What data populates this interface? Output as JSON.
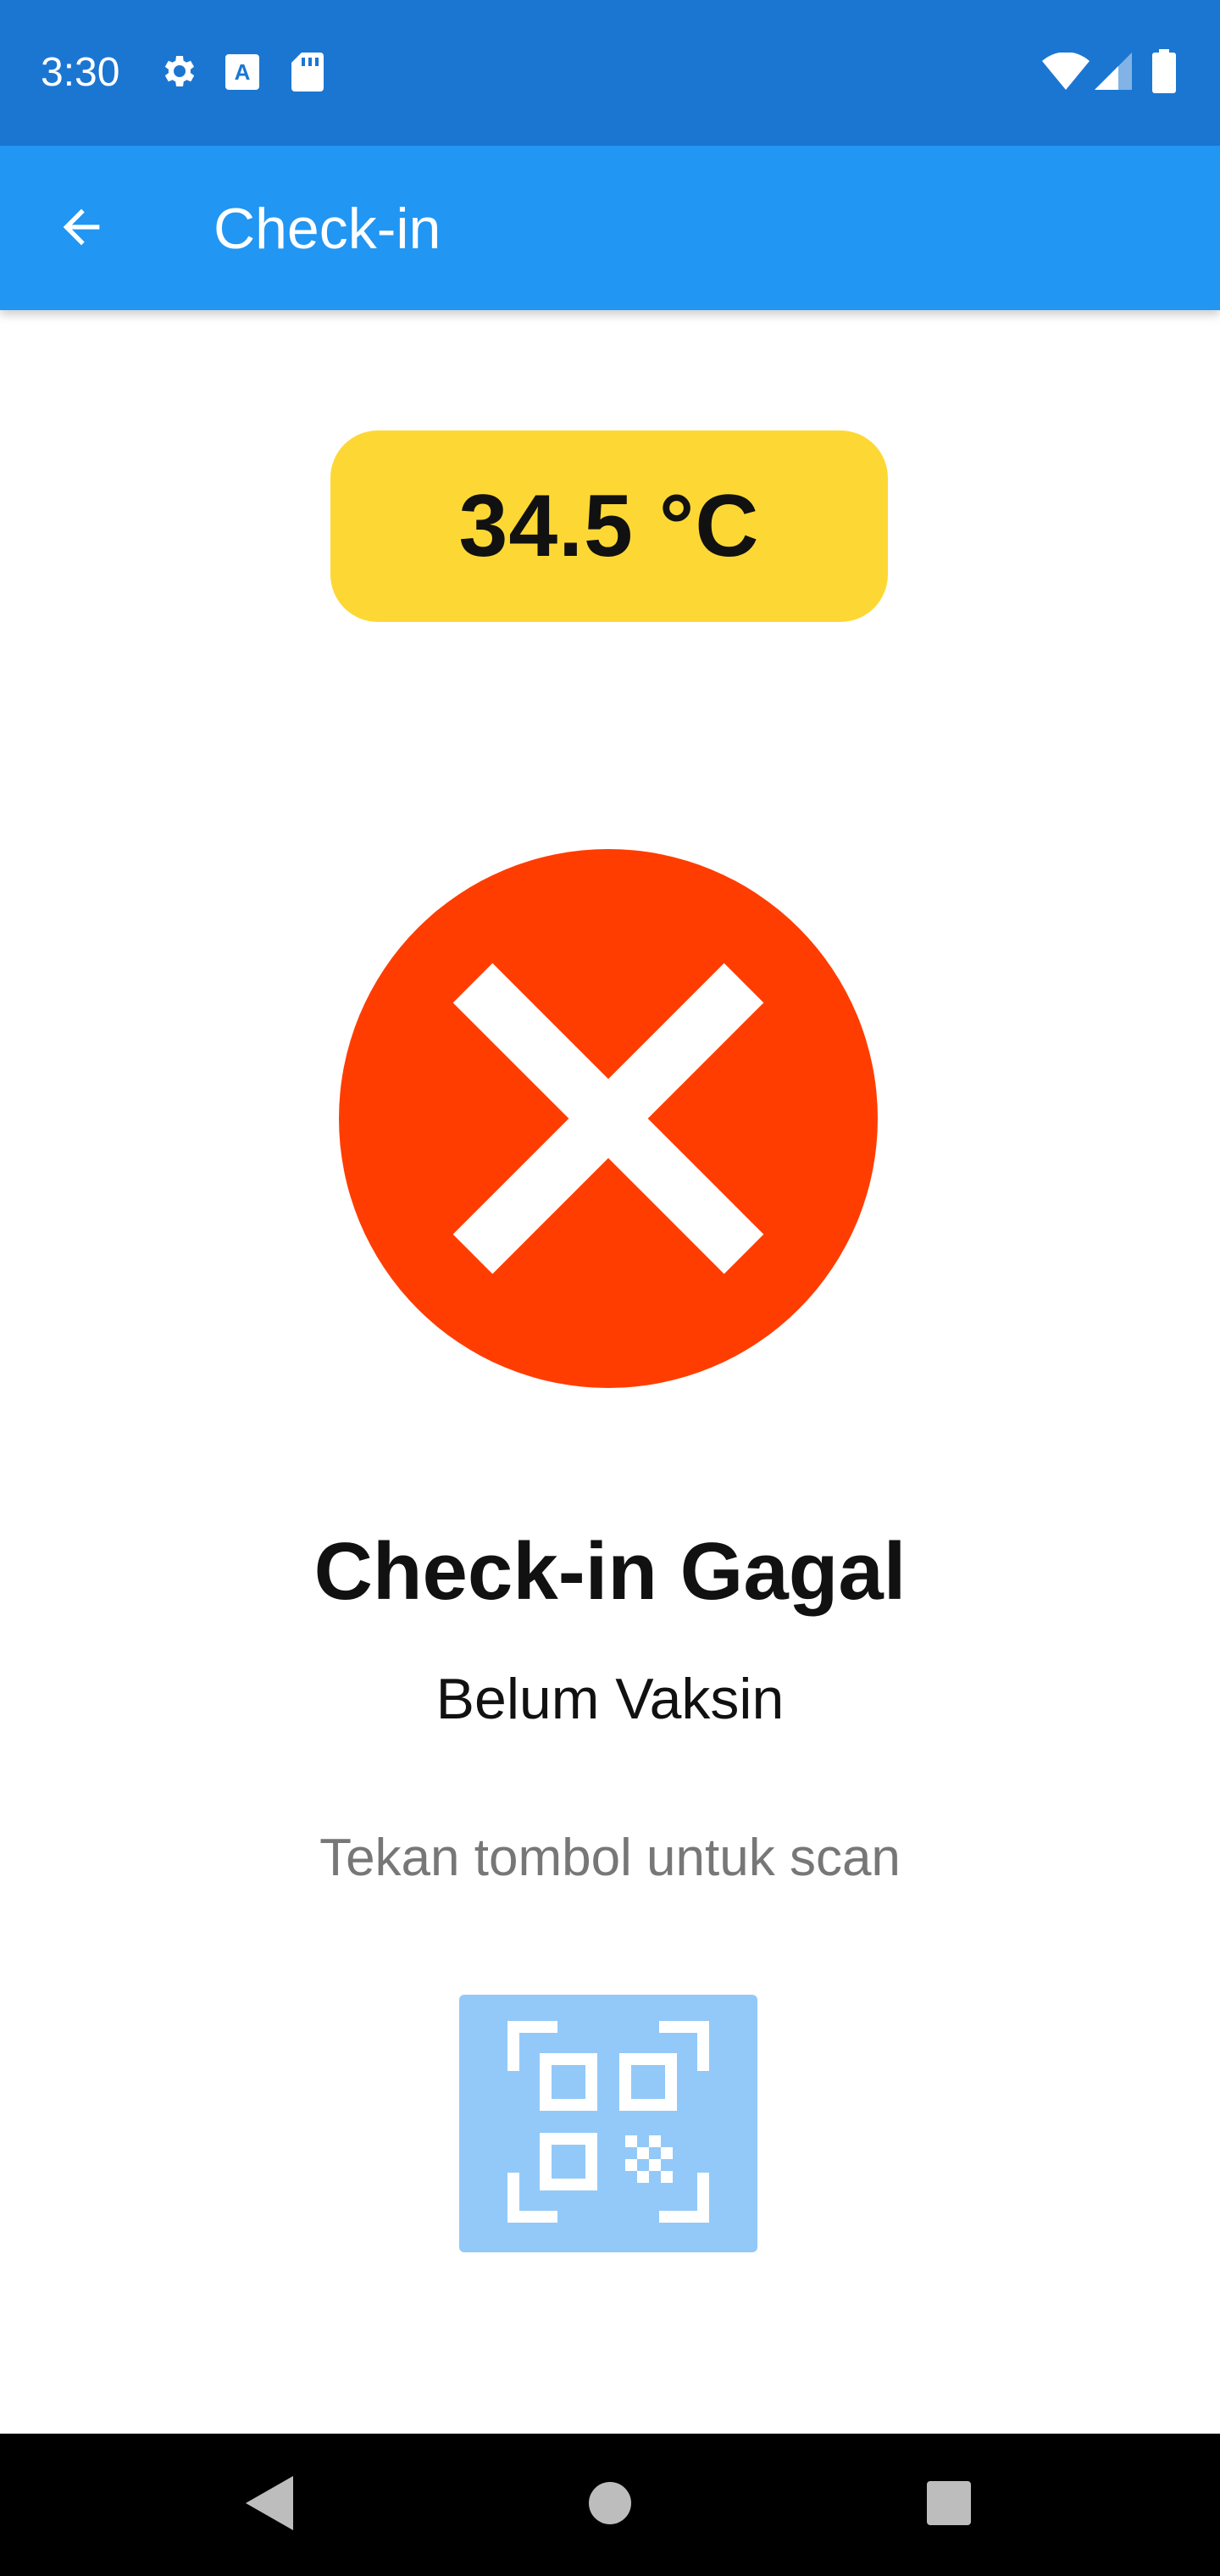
{
  "status_bar": {
    "time": "3:30",
    "icons_left": [
      "gear-icon",
      "text-a-icon",
      "sd-card-icon"
    ],
    "icons_right": [
      "wifi-icon",
      "signal-icon",
      "battery-icon"
    ],
    "background": "#1b76d2"
  },
  "app_bar": {
    "title": "Check-in",
    "back_icon": "arrow-back-icon",
    "background": "#2196f3"
  },
  "temperature": {
    "value": "34.5 °C",
    "badge_color": "#fdd835"
  },
  "result": {
    "icon": "close-circle-icon",
    "icon_color": "#ff3d00",
    "title": "Check-in Gagal",
    "subtitle": "Belum Vaksin"
  },
  "hint": "Tekan tombol untuk scan",
  "scan_button": {
    "icon": "qr-scan-icon",
    "background": "#93c9f8"
  },
  "nav_bar": {
    "items": [
      "nav-back-icon",
      "nav-home-icon",
      "nav-recents-icon"
    ]
  }
}
